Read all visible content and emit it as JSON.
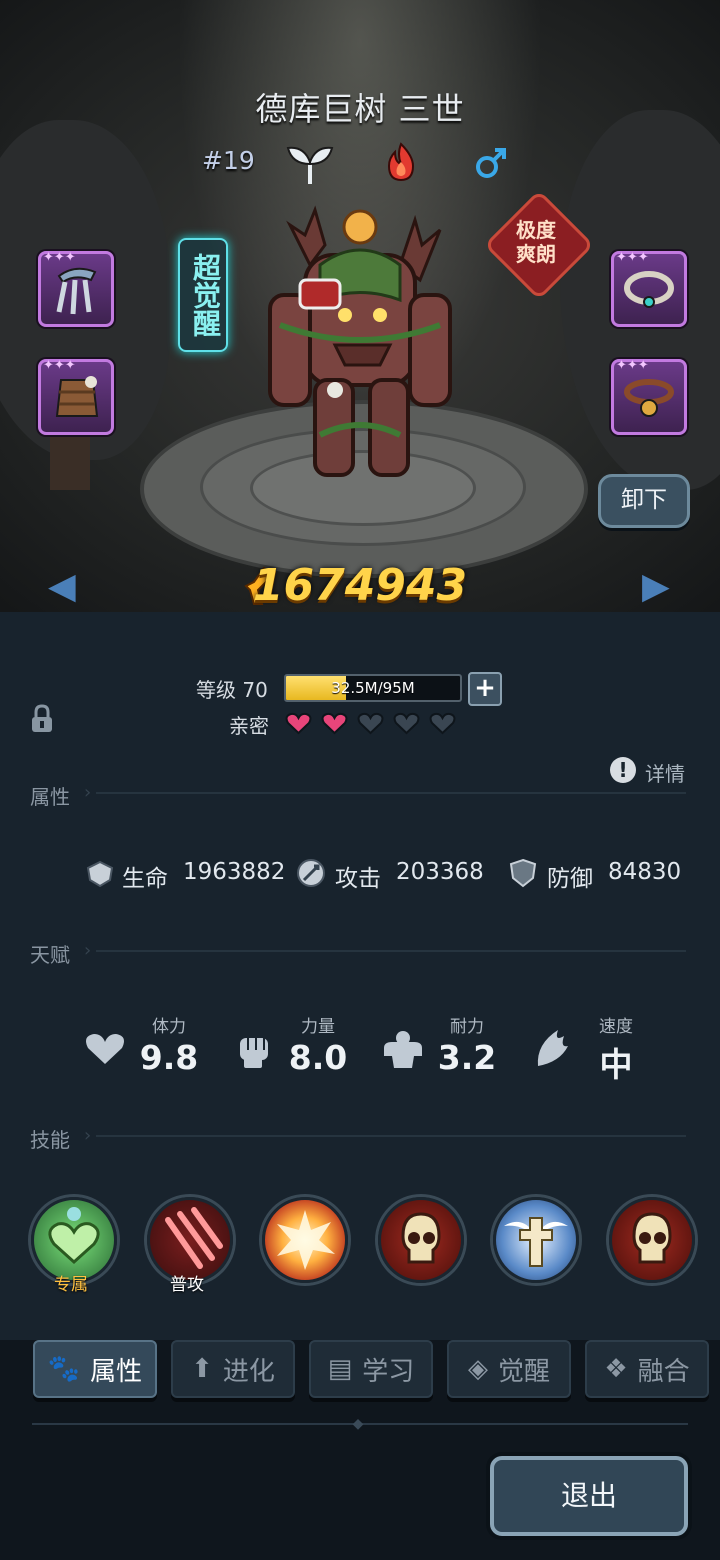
{
  "hero": {
    "name": "德库巨树 三世",
    "number": "#19",
    "type_icon": "sprout-icon",
    "element_icon": "fire-icon",
    "gender_icon": "male-icon",
    "awakening_badge": "超觉醒",
    "trait_badge_line1": "极度",
    "trait_badge_line2": "爽朗",
    "unequip_label": "卸下",
    "combat_power": "1674943",
    "colors": {
      "power": "#ffd44a",
      "fire": "#e23a30",
      "male": "#3aa8e8"
    }
  },
  "level": {
    "label": "等级 70",
    "exp_text": "32.5M/95M",
    "exp_progress": 0.342,
    "intimacy_label": "亲密",
    "hearts_filled": 2,
    "hearts_total": 5
  },
  "attributes": {
    "title": "属性",
    "details_label": "详情",
    "hp_label": "生命",
    "hp_value": "1963882",
    "atk_label": "攻击",
    "atk_value": "203368",
    "def_label": "防御",
    "def_value": "84830"
  },
  "talents": {
    "title": "天赋",
    "items": [
      {
        "name": "体力",
        "value": "9.8",
        "icon": "heart-icon"
      },
      {
        "name": "力量",
        "value": "8.0",
        "icon": "fist-icon"
      },
      {
        "name": "耐力",
        "value": "3.2",
        "icon": "muscle-icon"
      },
      {
        "name": "速度",
        "value": "中",
        "icon": "wing-icon"
      }
    ]
  },
  "skills": {
    "title": "技能",
    "items": [
      {
        "tag": "专属",
        "icon": "exclusive-skill-icon"
      },
      {
        "tag": "普攻",
        "icon": "claw-slash-icon"
      },
      {
        "tag": "",
        "icon": "explosion-icon"
      },
      {
        "tag": "",
        "icon": "skull-icon"
      },
      {
        "tag": "",
        "icon": "winged-cross-icon"
      },
      {
        "tag": "",
        "icon": "skull-icon"
      }
    ]
  },
  "tabs": [
    "属性",
    "进化",
    "学习",
    "觉醒",
    "融合"
  ],
  "exit_label": "退出"
}
